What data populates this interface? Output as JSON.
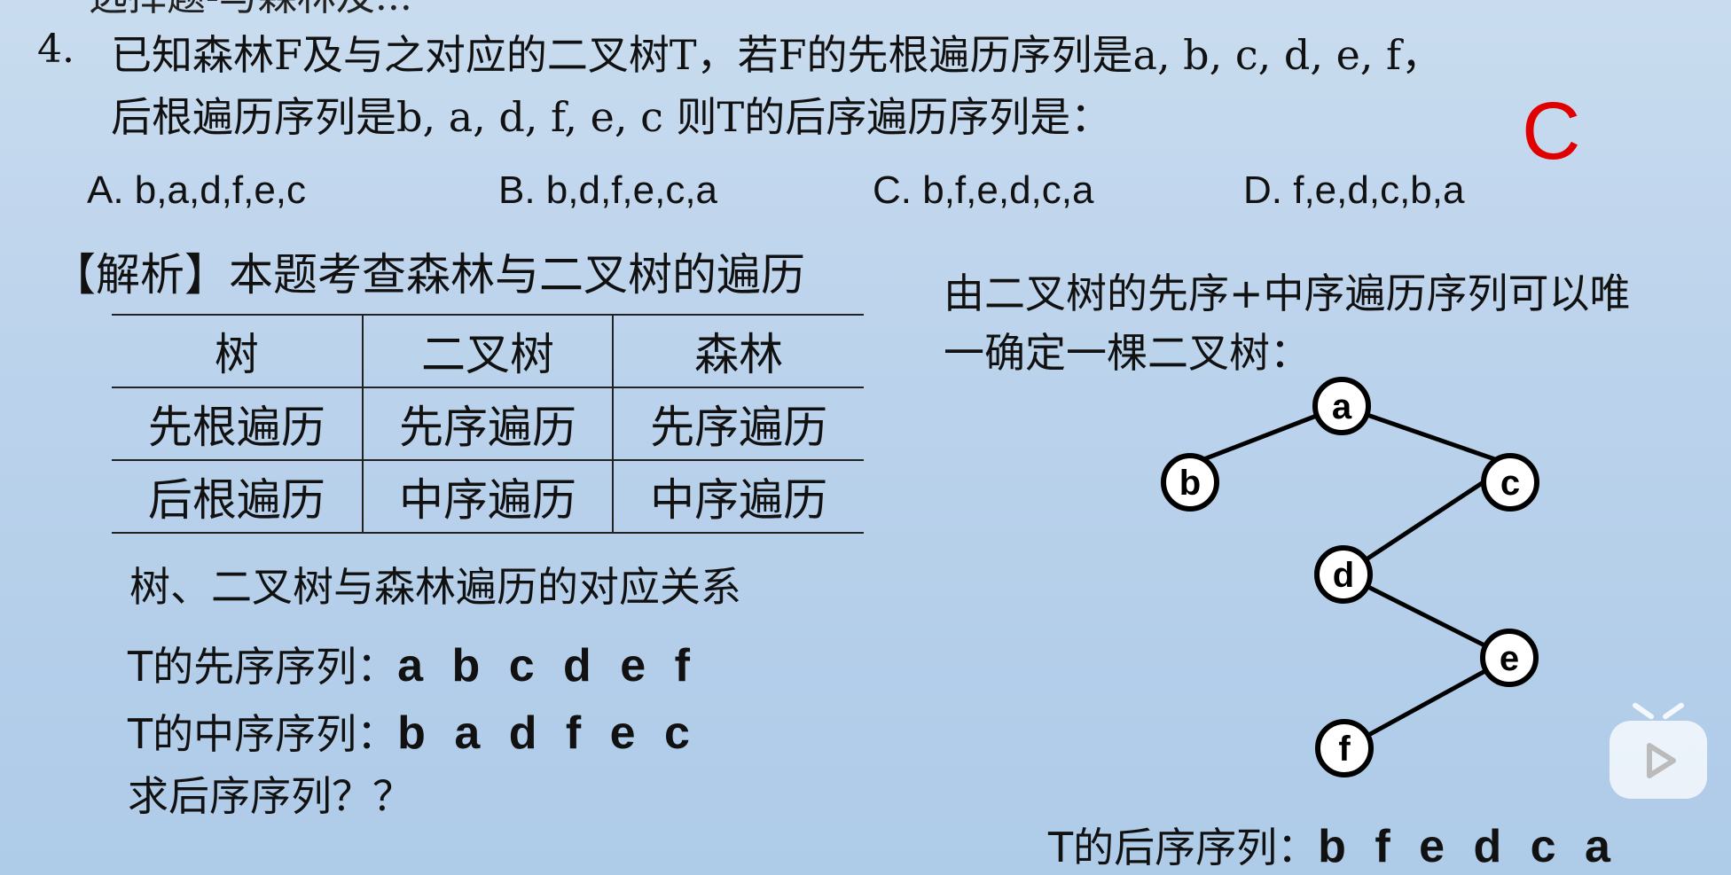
{
  "top_clip": "选择题-与森林及...",
  "question": {
    "number": "4.",
    "line1": "已知森林F及与之对应的二叉树T，若F的先根遍历序列是a, b, c, d, e, f，",
    "line2": "后根遍历序列是b, a, d, f, e, c  则T的后序遍历序列是："
  },
  "answer_mark": "C",
  "options": {
    "a": "A.  b,a,d,f,e,c",
    "b": "B.   b,d,f,e,c,a",
    "c": "C. b,f,e,d,c,a",
    "d": "D. f,e,d,c,b,a"
  },
  "analysis_title": "【解析】本题考查森林与二叉树的遍历",
  "table": {
    "headers": [
      "树",
      "二叉树",
      "森林"
    ],
    "rows": [
      [
        "先根遍历",
        "先序遍历",
        "先序遍历"
      ],
      [
        "后根遍历",
        "中序遍历",
        "中序遍历"
      ]
    ],
    "caption": "树、二叉树与森林遍历的对应关系"
  },
  "sequences": {
    "pre_label": "T的先序序列：",
    "pre_value": "a b c d e f",
    "in_label": "T的中序序列：",
    "in_value": "b a d f e c",
    "ask": "求后序序列？？",
    "post_label": "T的后序序列：",
    "post_value": "b f e d c a"
  },
  "right_text": {
    "line1": "由二叉树的先序+中序遍历序列可以唯",
    "line2": "一确定一棵二叉树："
  },
  "tree": {
    "nodes": [
      "a",
      "b",
      "c",
      "d",
      "e",
      "f"
    ],
    "edges": [
      [
        "a",
        "b"
      ],
      [
        "a",
        "c"
      ],
      [
        "c",
        "d"
      ],
      [
        "d",
        "e"
      ],
      [
        "e",
        "f"
      ]
    ]
  },
  "icons": {
    "player": "play-icon"
  }
}
